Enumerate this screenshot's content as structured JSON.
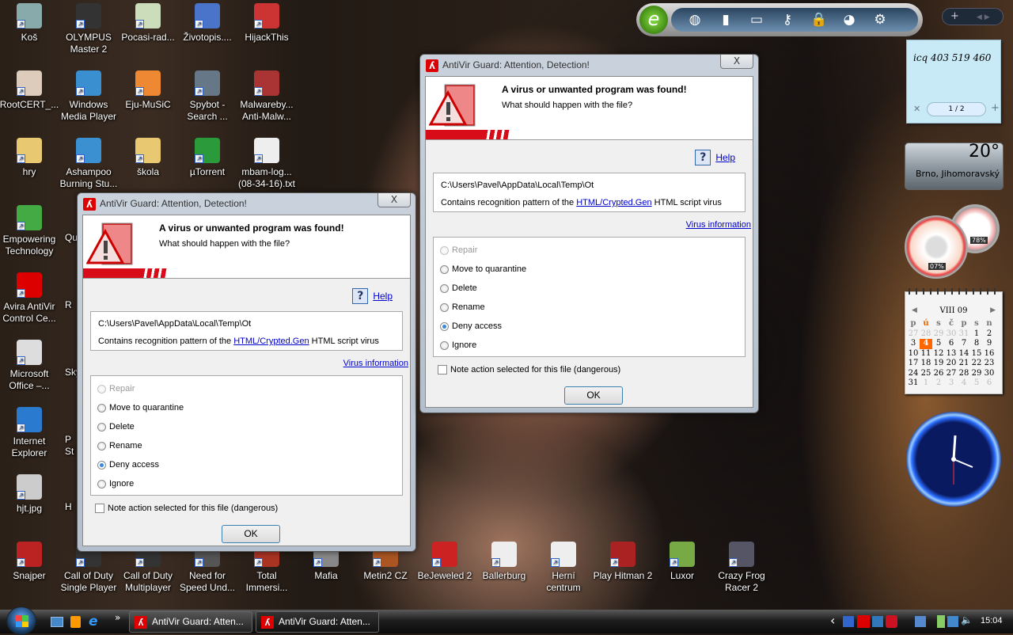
{
  "desktop_icons": [
    {
      "label": "Koš",
      "color": "#8aa"
    },
    {
      "label": "OLYMPUS Master 2",
      "color": "#333"
    },
    {
      "label": "Pocasi-rad...",
      "color": "#cdb"
    },
    {
      "label": "Životopis....",
      "color": "#4a74c9"
    },
    {
      "label": "HijackThis",
      "color": "#c33"
    },
    {
      "label": "RootCERT_...",
      "color": "#dcb"
    },
    {
      "label": "Windows Media Player",
      "color": "#3a8fd0"
    },
    {
      "label": "Eju-MuSiC",
      "color": "#e83"
    },
    {
      "label": "Spybot - Search ...",
      "color": "#678"
    },
    {
      "label": "Malwareby... Anti-Malw...",
      "color": "#a33"
    },
    {
      "label": "hry",
      "color": "#e8c870"
    },
    {
      "label": "Ashampoo Burning Stu...",
      "color": "#3a90d0"
    },
    {
      "label": "škola",
      "color": "#e8c870"
    },
    {
      "label": "µTorrent",
      "color": "#2a9a3a"
    },
    {
      "label": "mbam-log... (08-34-16).txt",
      "color": "#eee"
    },
    {
      "label": "Empowering Technology",
      "color": "#4a4"
    },
    {
      "label": "Avira AntiVir Control Ce...",
      "color": "#d00"
    },
    {
      "label": "Microsoft Office –...",
      "color": "#ddd"
    },
    {
      "label": "Internet Explorer",
      "color": "#2a7ad0"
    },
    {
      "label": "hjt.jpg",
      "color": "#ccc"
    }
  ],
  "partial_icons": [
    {
      "label": "Qu"
    },
    {
      "label": "R"
    },
    {
      "label": "Sky"
    },
    {
      "label": "P St"
    },
    {
      "label": "H"
    }
  ],
  "bottom_icons": [
    {
      "label": "Snajper",
      "color": "#b22"
    },
    {
      "label": "Call of Duty Single Player",
      "color": "#333"
    },
    {
      "label": "Call of Duty Multiplayer",
      "color": "#333"
    },
    {
      "label": "Need for Speed Und...",
      "color": "#555"
    },
    {
      "label": "Total Immersi...",
      "color": "#a32"
    },
    {
      "label": "Mafia",
      "color": "#888"
    },
    {
      "label": "Metin2 CZ",
      "color": "#a52"
    },
    {
      "label": "BeJeweled 2",
      "color": "#c22"
    },
    {
      "label": "Ballerburg",
      "color": "#eee"
    },
    {
      "label": "Herní centrum",
      "color": "#eee"
    },
    {
      "label": "Play Hitman 2",
      "color": "#a22"
    },
    {
      "label": "Luxor",
      "color": "#7a4"
    },
    {
      "label": "Crazy Frog Racer 2",
      "color": "#556"
    }
  ],
  "dialog": {
    "title": "AntiVir Guard: Attention, Detection!",
    "close": "X",
    "heading": "A virus or unwanted program was found!",
    "question": "What should happen with the file?",
    "help": "Help",
    "path": "C:\\Users\\Pavel\\AppData\\Local\\Temp\\Ot",
    "contains_prefix": "Contains recognition pattern of the",
    "virus_name": "HTML/Crypted.Gen",
    "contains_suffix": "HTML script virus",
    "virus_info": "Virus information",
    "options": [
      {
        "label": "Repair",
        "disabled": true
      },
      {
        "label": "Move to quarantine"
      },
      {
        "label": "Delete"
      },
      {
        "label": "Rename"
      },
      {
        "label": "Deny access",
        "selected": true
      },
      {
        "label": "Ignore"
      }
    ],
    "note": "Note action selected for this file (dangerous)",
    "ok": "OK",
    "accent": "#d80c18"
  },
  "sidebar_toolbar": {
    "icons": [
      "globe-icon",
      "battery-icon",
      "radio-icon",
      "key-icon",
      "lock-icon",
      "satellite-icon",
      "gear-icon"
    ]
  },
  "sticky_note": {
    "text": "icq 403 519 460",
    "page": "1 / 2"
  },
  "weather": {
    "temp": "20°",
    "location": "Brno, Jihomoravský"
  },
  "cpu_meter": {
    "cpu": "07%",
    "memory": "78%"
  },
  "calendar": {
    "month": "VIII 09",
    "weekdays": [
      "p",
      "ú",
      "s",
      "č",
      "p",
      "s",
      "n"
    ],
    "today": "4",
    "weeks": [
      [
        "27",
        "28",
        "29",
        "30",
        "31",
        "1",
        "2"
      ],
      [
        "3",
        "4",
        "5",
        "6",
        "7",
        "8",
        "9"
      ],
      [
        "10",
        "11",
        "12",
        "13",
        "14",
        "15",
        "16"
      ],
      [
        "17",
        "18",
        "19",
        "20",
        "21",
        "22",
        "23"
      ],
      [
        "24",
        "25",
        "26",
        "27",
        "28",
        "29",
        "30"
      ],
      [
        "31",
        "1",
        "2",
        "3",
        "4",
        "5",
        "6"
      ]
    ]
  },
  "taskbar": {
    "overflow": "»",
    "tasks": [
      "AntiVir Guard: Atten...",
      "AntiVir Guard: Atten..."
    ],
    "tray_arrow": "‹",
    "clock": "15:04"
  }
}
